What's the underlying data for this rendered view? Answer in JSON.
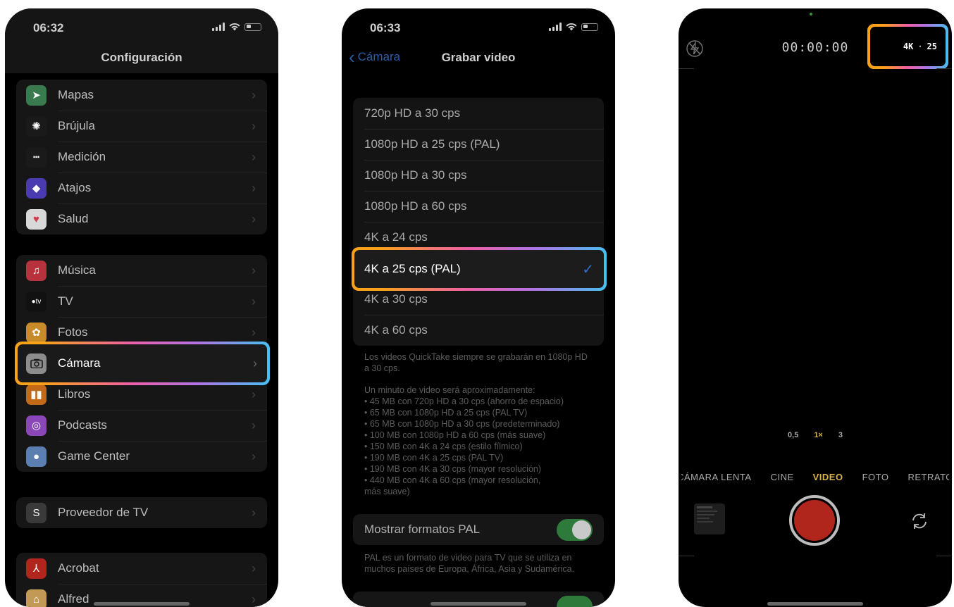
{
  "phone1": {
    "time": "06:32",
    "title": "Configuración",
    "groups": [
      [
        {
          "label": "Mapas",
          "icon": "maps-icon",
          "color": "#3a7a4f"
        },
        {
          "label": "Brújula",
          "icon": "compass-icon",
          "color": "#1a1a1a"
        },
        {
          "label": "Medición",
          "icon": "measure-icon",
          "color": "#1a1a1a"
        },
        {
          "label": "Atajos",
          "icon": "shortcuts-icon",
          "color": "#4a3cb0"
        },
        {
          "label": "Salud",
          "icon": "health-icon",
          "color": "#d8d8d8"
        }
      ],
      [
        {
          "label": "Música",
          "icon": "music-icon",
          "color": "#b8323e"
        },
        {
          "label": "TV",
          "icon": "tv-icon",
          "color": "#111111"
        },
        {
          "label": "Fotos",
          "icon": "photos-icon",
          "color": "#c98a2a"
        },
        {
          "label": "Cámara",
          "icon": "camera-icon",
          "color": "#8c8c8c"
        },
        {
          "label": "Libros",
          "icon": "books-icon",
          "color": "#c36a18"
        },
        {
          "label": "Podcasts",
          "icon": "podcasts-icon",
          "color": "#8a47b8"
        },
        {
          "label": "Game Center",
          "icon": "game-center-icon",
          "color": "#5a7fb0"
        }
      ],
      [
        {
          "label": "Proveedor de TV",
          "icon": "tv-provider-icon",
          "color": "#3a3a3a"
        }
      ],
      [
        {
          "label": "Acrobat",
          "icon": "acrobat-icon",
          "color": "#b1251d"
        },
        {
          "label": "Alfred",
          "icon": "alfred-icon",
          "color": "#c29a55"
        }
      ]
    ],
    "tv_glyph": "●tv"
  },
  "phone2": {
    "time": "06:33",
    "back_label": "Cámara",
    "title": "Grabar video",
    "options": [
      "720p HD a 30 cps",
      "1080p HD a 25 cps (PAL)",
      "1080p HD a 30 cps",
      "1080p HD a 60 cps",
      "4K a 24 cps",
      "4K a 25 cps (PAL)",
      "4K a 30 cps",
      "4K a 60 cps"
    ],
    "selected_index": 5,
    "note1": "Los videos QuickTake siempre se grabarán en 1080p HD a 30 cps.",
    "note2_lines": [
      "Un minuto de video será aproximadamente:",
      "• 45 MB con 720p HD a 30 cps (ahorro de espacio)",
      "• 65 MB con 1080p HD a 25 cps (PAL TV)",
      "• 65 MB con 1080p HD a 30 cps (predeterminado)",
      "• 100 MB con 1080p HD a 60 cps (más suave)",
      "• 150 MB con 4K a 24 cps (estilo fílmico)",
      "• 190 MB con 4K a 25 cps (PAL TV)",
      "• 190 MB con 4K a 30 cps (mayor resolución)",
      "• 440 MB con 4K a 60 cps (mayor resolución,",
      "más suave)"
    ],
    "pal_toggle_label": "Mostrar formatos PAL",
    "pal_toggle_on": true,
    "pal_note": "PAL es un formato de video para TV que se utiliza en muchos países de Europa, África, Asia y Sudamérica."
  },
  "phone3": {
    "timer": "00:00:00",
    "format_res": "4K",
    "format_sep": "·",
    "format_fps": "25",
    "zoom": [
      "0,5",
      "1×",
      "3"
    ],
    "zoom_active": 1,
    "modes": [
      "CÁMARA LENTA",
      "CINE",
      "VIDEO",
      "FOTO",
      "RETRATO"
    ],
    "mode_active": 2,
    "mode_active_color": "#d9b24a",
    "record_color": "#b0261d"
  },
  "highlight_gradient": [
    "#f9a11b",
    "#f15fa5",
    "#b074e6",
    "#46c0f0"
  ]
}
